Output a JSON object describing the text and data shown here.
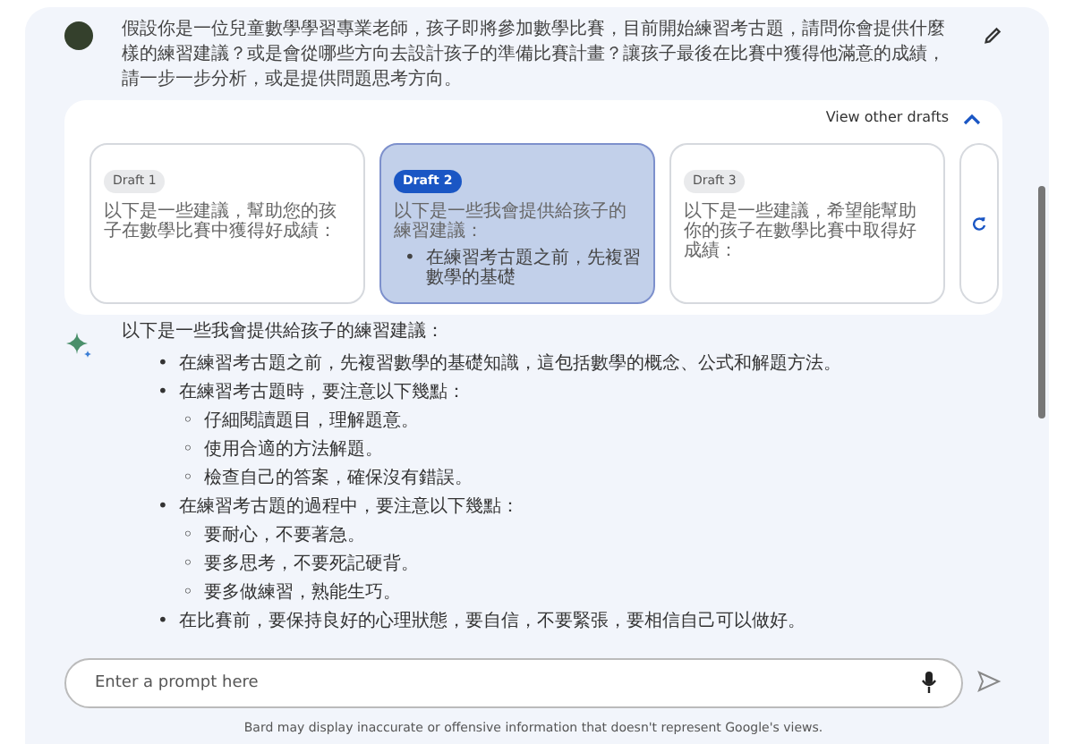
{
  "prompt": {
    "text": "假設你是一位兒童數學學習專業老師，孩子即將參加數學比賽，目前開始練習考古題，請問你會提供什麼樣的練習建議？或是會從哪些方向去設計孩子的準備比賽計畫？讓孩子最後在比賽中獲得他滿意的成績，請一步一步分析，或是提供問題思考方向。"
  },
  "drafts": {
    "toggle_label": "View other drafts",
    "expanded": true,
    "items": [
      {
        "label": "Draft 1",
        "selected": false,
        "preview": "以下是一些建議，幫助您的孩子在數學比賽中獲得好成績："
      },
      {
        "label": "Draft 2",
        "selected": true,
        "preview": "以下是一些我會提供給孩子的練習建議：",
        "bullets": [
          {
            "marker": "•",
            "text": "在練習考古題之前，先複習數學的基礎"
          }
        ]
      },
      {
        "label": "Draft 3",
        "selected": false,
        "preview": "以下是一些建議，希望能幫助你的孩子在數學比賽中取得好成績："
      }
    ]
  },
  "response": {
    "intro": "以下是一些我會提供給孩子的練習建議：",
    "items": [
      {
        "marker": "•",
        "text": "在練習考古題之前，先複習數學的基礎知識，這包括數學的概念、公式和解題方法。"
      },
      {
        "marker": "•",
        "text": "在練習考古題時，要注意以下幾點：",
        "children": [
          {
            "marker": "◦",
            "text": "仔細閱讀題目，理解題意。"
          },
          {
            "marker": "◦",
            "text": "使用合適的方法解題。"
          },
          {
            "marker": "◦",
            "text": "檢查自己的答案，確保沒有錯誤。"
          }
        ]
      },
      {
        "marker": "•",
        "text": "在練習考古題的過程中，要注意以下幾點：",
        "children": [
          {
            "marker": "◦",
            "text": "要耐心，不要著急。"
          },
          {
            "marker": "◦",
            "text": "要多思考，不要死記硬背。"
          },
          {
            "marker": "◦",
            "text": "要多做練習，熟能生巧。"
          }
        ]
      },
      {
        "marker": "•",
        "text": "在比賽前，要保持良好的心理狀態，要自信，不要緊張，要相信自己可以做好。"
      }
    ]
  },
  "input": {
    "placeholder": "Enter a prompt here"
  },
  "disclaimer": "Bard may display inaccurate or offensive information that doesn't represent Google's views."
}
